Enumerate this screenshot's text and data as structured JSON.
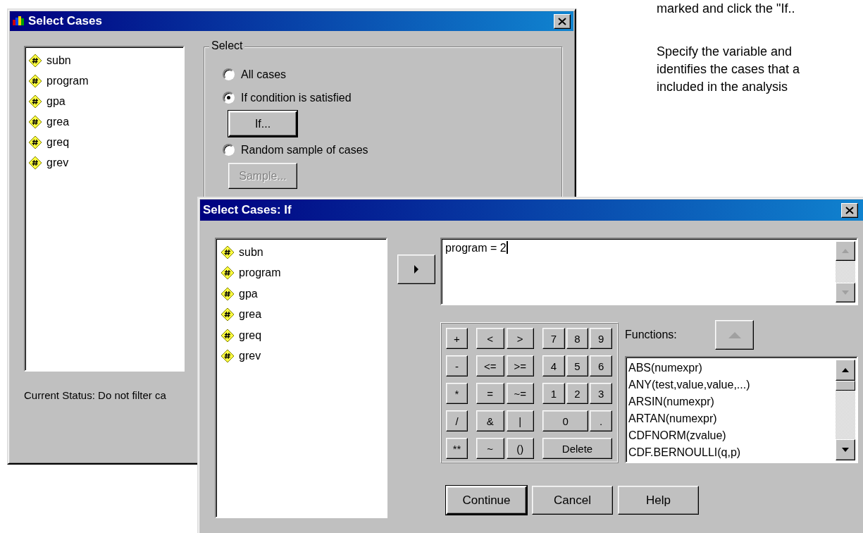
{
  "background_text": [
    "marked and click the \"If..",
    "Specify the variable and",
    "identifies the cases that a",
    "included in the analysis"
  ],
  "select_cases_dialog": {
    "title": "Select Cases",
    "variables": [
      "subn",
      "program",
      "gpa",
      "grea",
      "greq",
      "grev"
    ],
    "select_group": {
      "label": "Select",
      "options": [
        {
          "label": "All cases",
          "selected": false
        },
        {
          "label": "If condition is satisfied",
          "selected": true
        },
        {
          "label": "Random sample of cases",
          "selected": false
        }
      ],
      "if_button": {
        "label": "If...",
        "default": true,
        "disabled": false
      },
      "sample_button": {
        "label": "Sample...",
        "default": false,
        "disabled": true
      }
    },
    "status": "Current Status: Do not filter ca"
  },
  "if_dialog": {
    "title": "Select Cases: If",
    "variables": [
      "subn",
      "program",
      "gpa",
      "grea",
      "greq",
      "grev"
    ],
    "expression": "program = 2",
    "keypad": [
      {
        "operator": "+",
        "relations": [
          "<",
          ">"
        ],
        "digits": [
          "7",
          "8",
          "9"
        ]
      },
      {
        "operator": "-",
        "relations": [
          "<=",
          ">="
        ],
        "digits": [
          "4",
          "5",
          "6"
        ]
      },
      {
        "operator": "*",
        "relations": [
          "=",
          "~="
        ],
        "digits": [
          "1",
          "2",
          "3"
        ]
      },
      {
        "operator": "/",
        "relations": [
          "&",
          "|"
        ],
        "digits": [
          "0",
          "."
        ]
      },
      {
        "operator": "**",
        "relations": [
          "~",
          "()"
        ],
        "digits": [
          "Delete"
        ]
      }
    ],
    "functions_label": "Functions:",
    "functions": [
      "ABS(numexpr)",
      "ANY(test,value,value,...)",
      "ARSIN(numexpr)",
      "ARTAN(numexpr)",
      "CDFNORM(zvalue)",
      "CDF.BERNOULLI(q,p)"
    ],
    "buttons": [
      {
        "label": "Continue",
        "default": true
      },
      {
        "label": "Cancel",
        "default": false
      },
      {
        "label": "Help",
        "default": false
      }
    ]
  }
}
